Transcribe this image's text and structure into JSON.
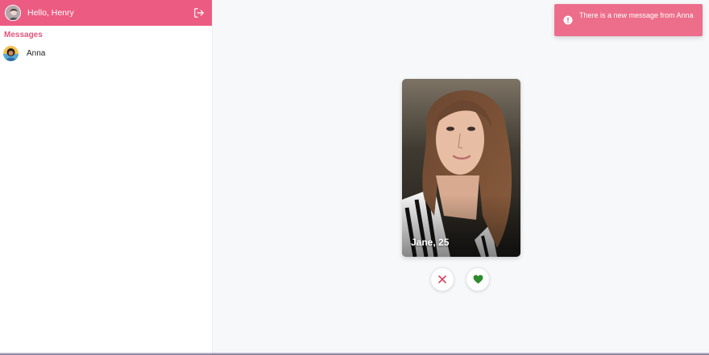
{
  "sidebar": {
    "greeting": "Hello, Henry",
    "section_title": "Messages",
    "conversations": [
      {
        "name": "Anna"
      }
    ]
  },
  "profile_card": {
    "caption": "Jane, 25"
  },
  "actions": {
    "reject_icon": "close-icon",
    "like_icon": "heart-icon"
  },
  "toast": {
    "message": "There is a new message from Anna",
    "icon": "info-icon"
  },
  "colors": {
    "brand": "#ec5c82",
    "section_title": "#e3557c",
    "toast": "#ed6e8a",
    "reject": "#d9435c",
    "like": "#2e8b2e"
  }
}
